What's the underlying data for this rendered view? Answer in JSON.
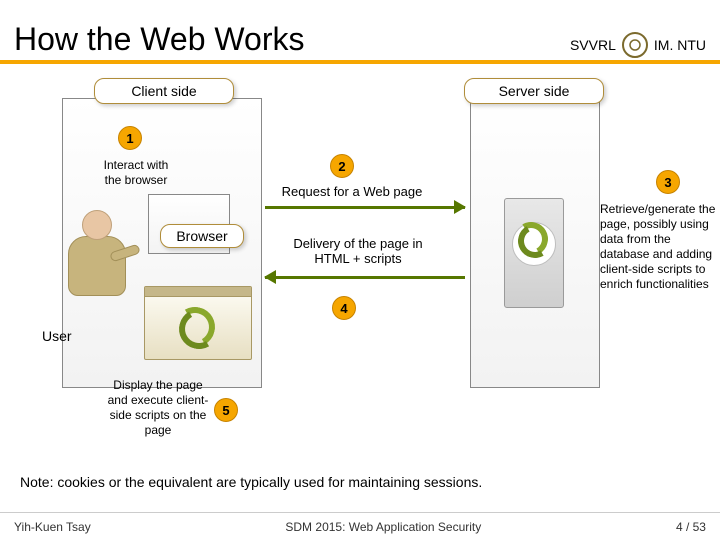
{
  "header": {
    "title": "How the Web Works",
    "affiliation_left": "SVVRL",
    "affiliation_right": "IM. NTU"
  },
  "columns": {
    "client_label": "Client side",
    "server_label": "Server side"
  },
  "actors": {
    "user": "User",
    "browser": "Browser"
  },
  "steps": {
    "s1": "1",
    "s1_text": "Interact with\nthe browser",
    "s2": "2",
    "s2_text": "Request for a Web page",
    "s3": "3",
    "s3_text": "Retrieve/generate the page, possibly using data from the database and adding client-side scripts to enrich functionalities",
    "s4": "4",
    "s4_text": "Delivery of the page in\nHTML + scripts",
    "s5": "5",
    "s5_text": "Display the page and execute client-side scripts on the page"
  },
  "note": "Note: cookies or the equivalent are typically used for maintaining sessions.",
  "footer": {
    "author": "Yih-Kuen Tsay",
    "venue": "SDM 2015: Web Application Security",
    "page": "4 / 53"
  }
}
